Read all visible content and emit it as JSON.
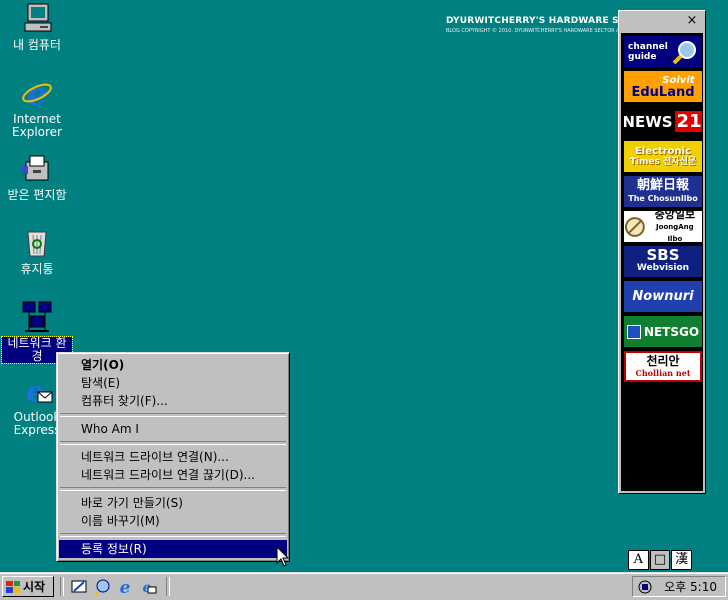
{
  "desktop": {
    "icons": [
      {
        "label": "내 컴퓨터",
        "icon": "my-computer-icon"
      },
      {
        "label": "Internet Explorer",
        "icon": "internet-explorer-icon"
      },
      {
        "label": "받은 편지함",
        "icon": "inbox-icon"
      },
      {
        "label": "휴지통",
        "icon": "recycle-bin-icon"
      },
      {
        "label": "네트워크 환경",
        "icon": "network-neighborhood-icon"
      },
      {
        "label": "Outlook Express",
        "icon": "outlook-express-icon"
      }
    ],
    "watermark_title": "DYURWITCHERRY'S HARDWARE SECTOR",
    "watermark_sub": "BLOG COPYRIGHT © 2010. DYURWITCHERRY'S HARDWARE SECTOR ALL RIGHTS RESERVED."
  },
  "channel_bar": {
    "close_label": "×",
    "channels": [
      {
        "line1": "channel",
        "line2": "guide"
      },
      {
        "line1": "Solvit",
        "line2": "EduLand"
      },
      {
        "line1": "NEWS",
        "line2": "21"
      },
      {
        "line1": "Electronic",
        "line2": "Times 전자신문"
      },
      {
        "line1": "朝鮮日報",
        "line2": "The ChosunIlbo"
      },
      {
        "line1": "중앙일보",
        "line2": "JoongAng Ilbo"
      },
      {
        "line1": "SBS",
        "line2": "Webvision"
      },
      {
        "line1": "Nownuri",
        "line2": ""
      },
      {
        "line1": "NETSGO",
        "line2": ""
      },
      {
        "line1": "천리안",
        "line2": "Chollian net"
      }
    ]
  },
  "context_menu": {
    "items": [
      {
        "label": "열기(O)",
        "bold": true
      },
      {
        "label": "탐색(E)"
      },
      {
        "label": "컴퓨터 찾기(F)..."
      },
      {
        "label": "Who Am I"
      },
      {
        "label": "네트워크 드라이브 연결(N)..."
      },
      {
        "label": "네트워크 드라이브 연결 끊기(D)..."
      },
      {
        "label": "바로 가기 만들기(S)"
      },
      {
        "label": "이름 바꾸기(M)"
      },
      {
        "label": "등록 정보(R)",
        "highlighted": true
      }
    ]
  },
  "ime": {
    "a": "A",
    "dot": "□",
    "han": "漢"
  },
  "taskbar": {
    "start_label": "시작",
    "clock": "오후 5:10"
  },
  "colors": {
    "desktop": "#008080",
    "highlight": "#000080",
    "face": "#c0c0c0"
  }
}
